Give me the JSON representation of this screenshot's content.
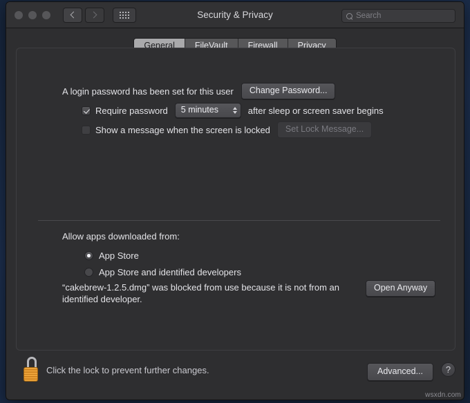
{
  "window": {
    "title": "Security & Privacy"
  },
  "titlebar": {
    "back_icon": "chevron-left-icon",
    "forward_icon": "chevron-right-icon",
    "showall_icon": "grid-icon",
    "search": {
      "placeholder": "Search",
      "value": "",
      "icon": "search-icon"
    }
  },
  "tabs": [
    {
      "label": "General",
      "active": true
    },
    {
      "label": "FileVault",
      "active": false
    },
    {
      "label": "Firewall",
      "active": false
    },
    {
      "label": "Privacy",
      "active": false
    }
  ],
  "general": {
    "login_password_text": "A login password has been set for this user",
    "change_password_button": "Change Password...",
    "require_password": {
      "checked": true,
      "label": "Require password",
      "interval_value": "5 minutes",
      "suffix": "after sleep or screen saver begins"
    },
    "show_message": {
      "checked": false,
      "label": "Show a message when the screen is locked",
      "set_lock_message_button": "Set Lock Message...",
      "button_disabled": true
    }
  },
  "gatekeeper": {
    "section_title": "Allow apps downloaded from:",
    "options": [
      {
        "label": "App Store",
        "selected": true
      },
      {
        "label": "App Store and identified developers",
        "selected": false
      }
    ],
    "blocked_message": "“cakebrew-1.2.5.dmg” was blocked from use because it is not from an identified developer.",
    "open_anyway_button": "Open Anyway"
  },
  "footer": {
    "lock_icon": "unlocked-padlock-icon",
    "lock_message": "Click the lock to prevent further changes.",
    "advanced_button": "Advanced...",
    "help_button": "?"
  },
  "watermark": "wsxdn.com",
  "colors": {
    "window_bg": "#2e2e30",
    "titlebar_bg": "#323234",
    "panel_bg": "#2f2f31",
    "text": "#e3e3e7",
    "active_tab_bg": "#a9a9ab",
    "lock_gold": "#eda43a"
  }
}
